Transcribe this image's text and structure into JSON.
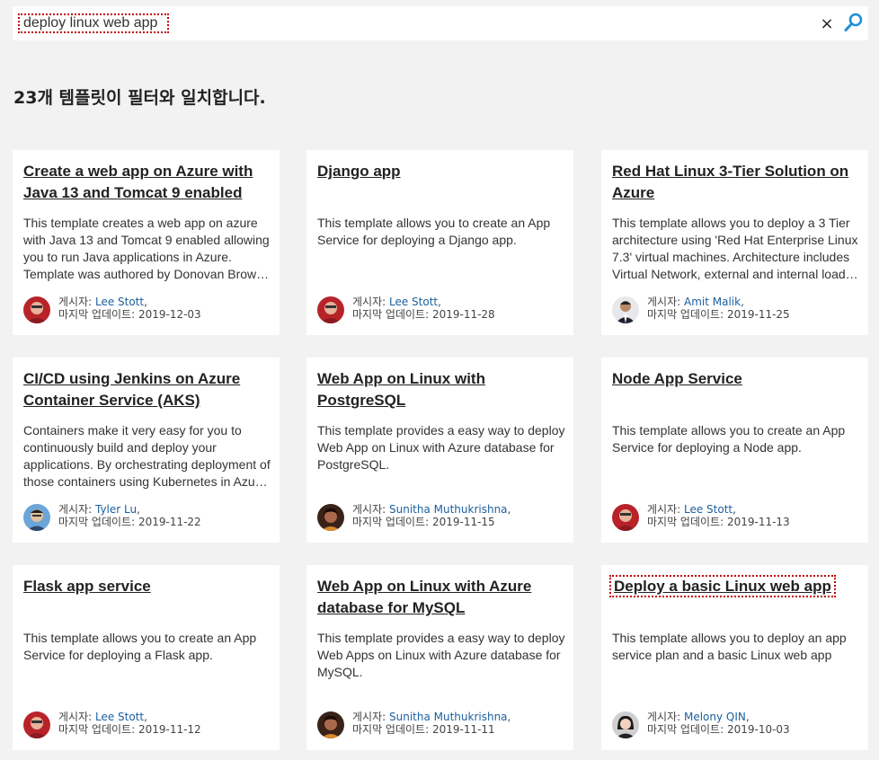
{
  "search": {
    "value": "deploy linux web app",
    "clear_label": "×"
  },
  "results": {
    "heading": "23개 템플릿이 필터와 일치합니다."
  },
  "labels": {
    "author_prefix": "게시자: ",
    "updated_prefix": "마지막 업데이트: "
  },
  "cards": [
    {
      "title": "Create a web app on Azure with Java 13 and Tomcat 9 enabled",
      "description": "This template creates a web app on azure with Java 13 and Tomcat 9 enabled allowing you to run Java applications in Azure. Template was authored by Donovan Brown of Microsoft.",
      "author": "Lee Stott",
      "date": "2019-12-03",
      "avatar": "avatar-red"
    },
    {
      "title": "Django app",
      "description": "This template allows you to create an App Service for deploying a Django app.",
      "author": "Lee Stott",
      "date": "2019-11-28",
      "avatar": "avatar-red"
    },
    {
      "title": "Red Hat Linux 3-Tier Solution on Azure",
      "description": "This template allows you to deploy a 3 Tier architecture using 'Red Hat Enterprise Linux 7.3' virtual machines. Architecture includes Virtual Network, external and internal load balancers.",
      "author": "Amit Malik",
      "date": "2019-11-25",
      "avatar": "avatar-suit"
    },
    {
      "title": "CI/CD using Jenkins on Azure Container Service (AKS)",
      "description": "Containers make it very easy for you to continuously build and deploy your applications. By orchestrating deployment of those containers using Kubernetes in Azure Container Service.",
      "author": "Tyler Lu",
      "date": "2019-11-22",
      "avatar": "avatar-blue"
    },
    {
      "title": "Web App on Linux with PostgreSQL",
      "description": "This template provides a easy way to deploy Web App on Linux with Azure database for PostgreSQL.",
      "author": "Sunitha Muthukrishna",
      "date": "2019-11-15",
      "avatar": "avatar-dark"
    },
    {
      "title": "Node App Service",
      "description": "This template allows you to create an App Service for deploying a Node app.",
      "author": "Lee Stott",
      "date": "2019-11-13",
      "avatar": "avatar-red"
    },
    {
      "title": "Flask app service",
      "description": "This template allows you to create an App Service for deploying a Flask app.",
      "author": "Lee Stott",
      "date": "2019-11-12",
      "avatar": "avatar-red"
    },
    {
      "title": "Web App on Linux with Azure database for MySQL",
      "description": "This template provides a easy way to deploy Web Apps on Linux with Azure database for MySQL.",
      "author": "Sunitha Muthukrishna",
      "date": "2019-11-11",
      "avatar": "avatar-dark"
    },
    {
      "title": "Deploy a basic Linux web app",
      "description": "This template allows you to deploy an app service plan and a basic Linux web app",
      "author": "Melony QIN",
      "date": "2019-10-03",
      "avatar": "avatar-gray"
    }
  ],
  "colors": {
    "background": "#f2f2f2",
    "link": "#1c5f9e",
    "highlight_border": "#c00000",
    "search_icon": "#1e8fd5"
  }
}
